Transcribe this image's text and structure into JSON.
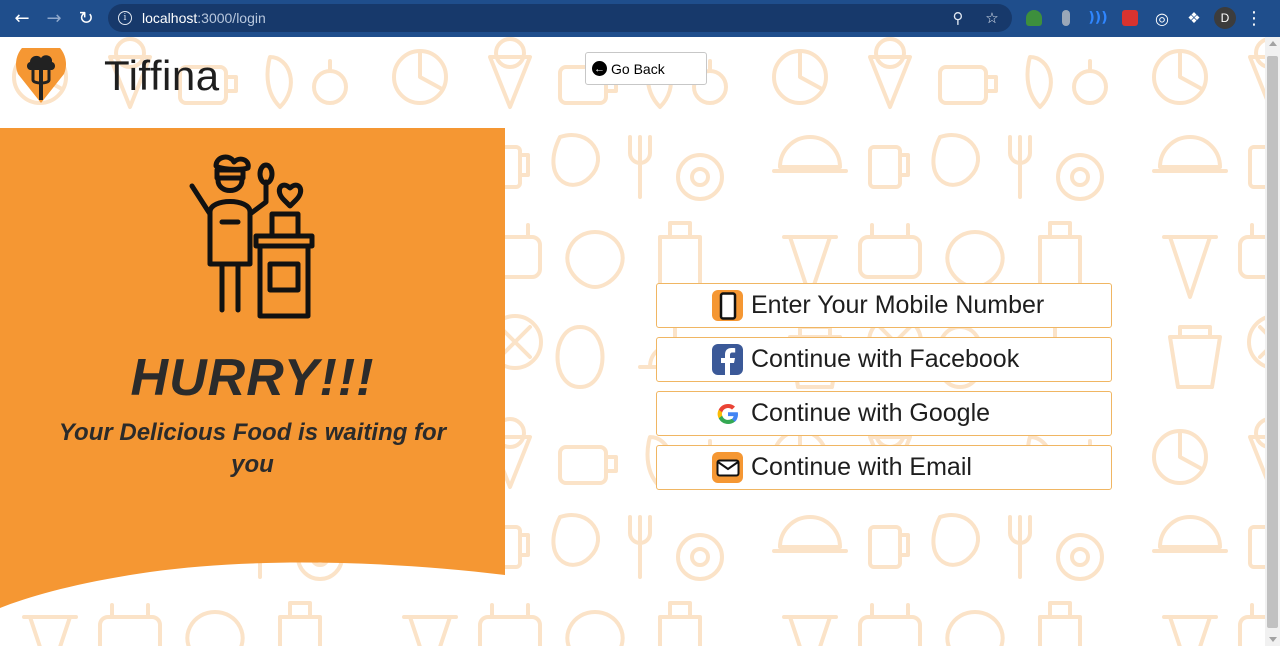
{
  "browser": {
    "url_host": "localhost",
    "url_path": ":3000/login",
    "profile_initial": "D"
  },
  "header": {
    "brand": "Tiffina",
    "go_back_label": "Go Back"
  },
  "promo": {
    "headline": "HURRY!!!",
    "tagline": "Your Delicious Food is waiting for you",
    "color": "#f59733"
  },
  "login_options": [
    {
      "label": "Enter Your Mobile Number",
      "icon": "mobile-phone-icon"
    },
    {
      "label": "Continue with Facebook",
      "icon": "facebook-icon"
    },
    {
      "label": "Continue with Google",
      "icon": "google-icon"
    },
    {
      "label": "Continue with Email",
      "icon": "email-icon"
    }
  ],
  "colors": {
    "accent": "#f59733",
    "button_border": "#f0b663",
    "facebook": "#3b5998",
    "chrome": "#1f4e8c"
  }
}
